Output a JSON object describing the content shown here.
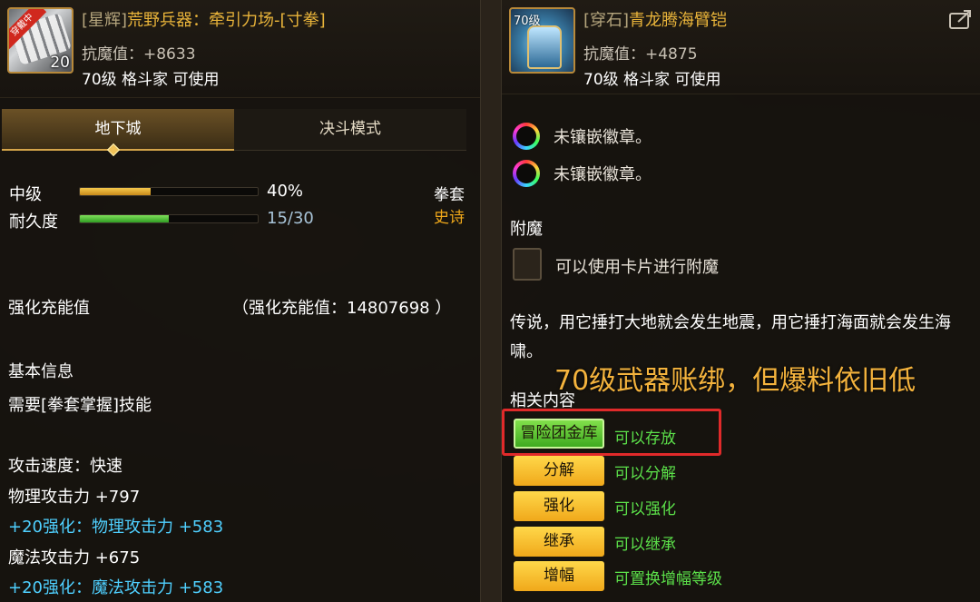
{
  "left": {
    "item": {
      "tag": "[星辉]",
      "name": "荒野兵器：牵引力场-[寸拳]",
      "equipped_badge": "穿戴中",
      "level_badge": "20",
      "resist": "抗魔值：+8633",
      "requirement": "70级 格斗家 可使用"
    },
    "tabs": [
      {
        "label": "地下城",
        "active": true
      },
      {
        "label": "决斗模式",
        "active": false
      }
    ],
    "grade": {
      "label": "中级",
      "value": "40%",
      "fill": 0.4
    },
    "durability": {
      "label": "耐久度",
      "value": "15/30",
      "fill": 0.5
    },
    "weapon_type": "拳套",
    "rarity": "史诗",
    "charge": {
      "label": "强化充能值",
      "value": "（强化充能值：14807698 ）"
    },
    "basic_info": {
      "heading": "基本信息",
      "skill_req": "需要[拳套掌握]技能"
    },
    "stats": {
      "attack_speed": "攻击速度：快速",
      "phys_attack": "物理攻击力 +797",
      "phys_bonus": "+20强化：物理攻击力 +583",
      "mag_attack": "魔法攻击力 +675",
      "mag_bonus": "+20强化：魔法攻击力 +583"
    }
  },
  "right": {
    "item": {
      "tag": "[穿石]",
      "name": "青龙腾海臂铠",
      "level_badge": "70级",
      "resist": "抗魔值：+4875",
      "requirement": "70级 格斗家 可使用"
    },
    "sockets": [
      {
        "text": "未镶嵌徽章。"
      },
      {
        "text": "未镶嵌徽章。"
      }
    ],
    "enchant": {
      "heading": "附魔",
      "text": "可以使用卡片进行附魔"
    },
    "lore": "传说，用它捶打大地就会发生地震，用它捶打海面就会发生海啸。",
    "caption": "70级武器账绑，但爆料依旧低",
    "related": {
      "heading": "相关内容",
      "actions": [
        {
          "label": "冒险团金库",
          "desc": "可以存放"
        },
        {
          "label": "分解",
          "desc": "可以分解"
        },
        {
          "label": "强化",
          "desc": "可以强化"
        },
        {
          "label": "继承",
          "desc": "可以继承"
        },
        {
          "label": "增幅",
          "desc": "可置换增幅等级"
        }
      ]
    }
  },
  "colors": {
    "gold_title": "#e9b43a",
    "bonus_blue": "#4fd0ff",
    "green_text": "#5ce14a",
    "highlight_red": "#e02a2a",
    "caption_orange": "#f4b33d"
  }
}
